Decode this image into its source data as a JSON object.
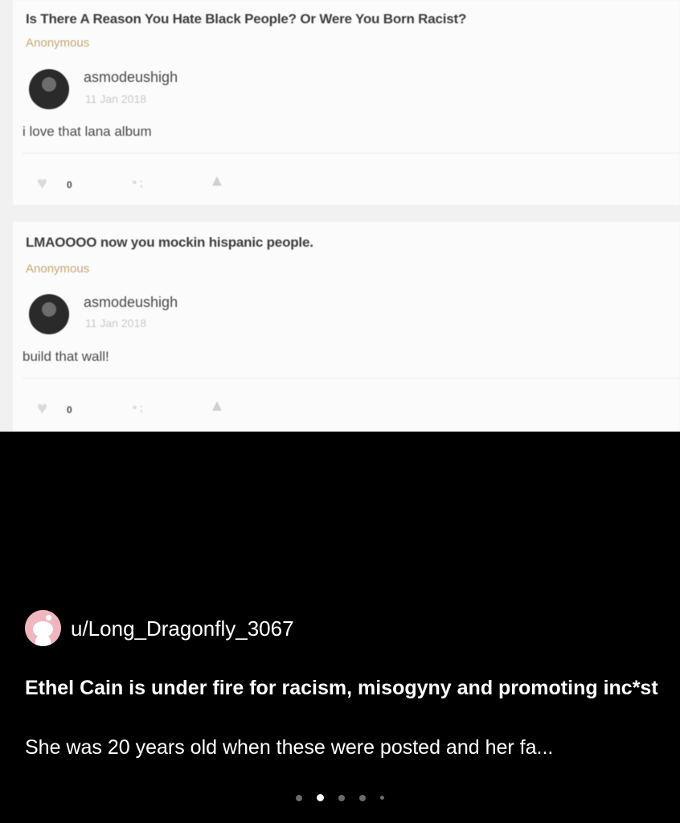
{
  "screenshot": {
    "posts": [
      {
        "question": "Is There A Reason You Hate Black People? Or Were You Born Racist?",
        "asker": "Anonymous",
        "username": "asmodeushigh",
        "date": "11 Jan 2018",
        "answer": "i love that lana album",
        "likes": "0"
      },
      {
        "question": "LMAOOOO now you mockin hispanic people.",
        "asker": "Anonymous",
        "username": "asmodeushigh",
        "date": "11 Jan 2018",
        "answer": "build that wall!",
        "likes": "0"
      }
    ]
  },
  "reddit_post": {
    "username": "u/Long_Dragonfly_3067",
    "title": "Ethel Cain is under fire for racism, misogyny and promoting inc*st",
    "body_preview": "She was 20 years old when these were posted and her fa...",
    "carousel_count": 5,
    "carousel_active_index": 1
  },
  "colors": {
    "asker": "#c8a773",
    "background": "#000000",
    "avatar": "#f0b6bf"
  }
}
